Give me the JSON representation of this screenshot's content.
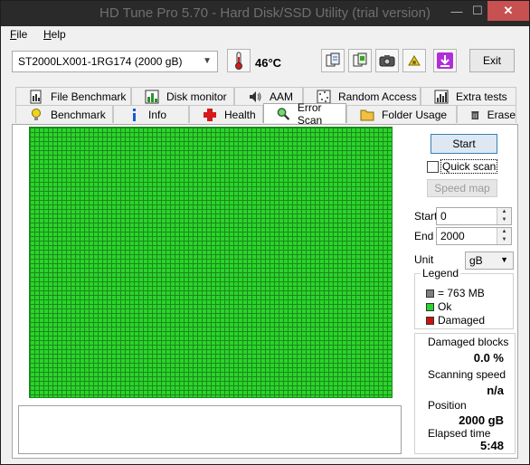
{
  "window": {
    "title": "HD Tune Pro 5.70 - Hard Disk/SSD Utility (trial version)",
    "minimize": "—",
    "maximize": "☐",
    "close": "✕"
  },
  "menu": [
    {
      "label": "File",
      "accel": "F",
      "rest": "ile"
    },
    {
      "label": "Help",
      "accel": "H",
      "rest": "elp"
    }
  ],
  "toolbar": {
    "drive": "ST2000LX001-1RG174 (2000 gB)",
    "temperature": "46°C",
    "exit_label": "Exit",
    "buttons": [
      "copy-info-icon",
      "copy-screen-icon",
      "camera-icon",
      "health-settings-icon",
      "download-icon"
    ]
  },
  "tabs_top": [
    {
      "label": "File Benchmark",
      "icon": "file-benchmark-icon"
    },
    {
      "label": "Disk monitor",
      "icon": "disk-monitor-icon"
    },
    {
      "label": "AAM",
      "icon": "speaker-icon"
    },
    {
      "label": "Random Access",
      "icon": "random-access-icon"
    },
    {
      "label": "Extra tests",
      "icon": "extra-tests-icon"
    }
  ],
  "tabs_bottom": [
    {
      "label": "Benchmark",
      "icon": "lightbulb-icon"
    },
    {
      "label": "Info",
      "icon": "info-icon"
    },
    {
      "label": "Health",
      "icon": "health-cross-icon"
    },
    {
      "label": "Error Scan",
      "icon": "magnifier-icon",
      "active": true
    },
    {
      "label": "Folder Usage",
      "icon": "folder-icon"
    },
    {
      "label": "Erase",
      "icon": "trash-icon"
    }
  ],
  "error_scan": {
    "start_label": "Start",
    "quick_scan_label": "Quick scan",
    "quick_scan_checked": false,
    "speed_map_label": "Speed map",
    "start_field_label": "Start",
    "start_value": "0",
    "end_field_label": "End",
    "end_value": "2000",
    "unit_label": "Unit",
    "unit_value": "gB",
    "legend": {
      "title": "Legend",
      "block_size": "= 763 MB",
      "ok": "Ok",
      "damaged": "Damaged"
    },
    "stats": {
      "damaged_blocks_label": "Damaged blocks",
      "damaged_blocks_value": "0.0 %",
      "scanning_speed_label": "Scanning speed",
      "scanning_speed_value": "n/a",
      "position_label": "Position",
      "position_value": "2000 gB",
      "elapsed_label": "Elapsed time",
      "elapsed_value": "5:48"
    },
    "grid_status": "ok"
  },
  "colors": {
    "ok": "#2bd42b",
    "damaged": "#d01010",
    "block": "#7f7f7f",
    "grid_line": "#1a8a1a"
  }
}
